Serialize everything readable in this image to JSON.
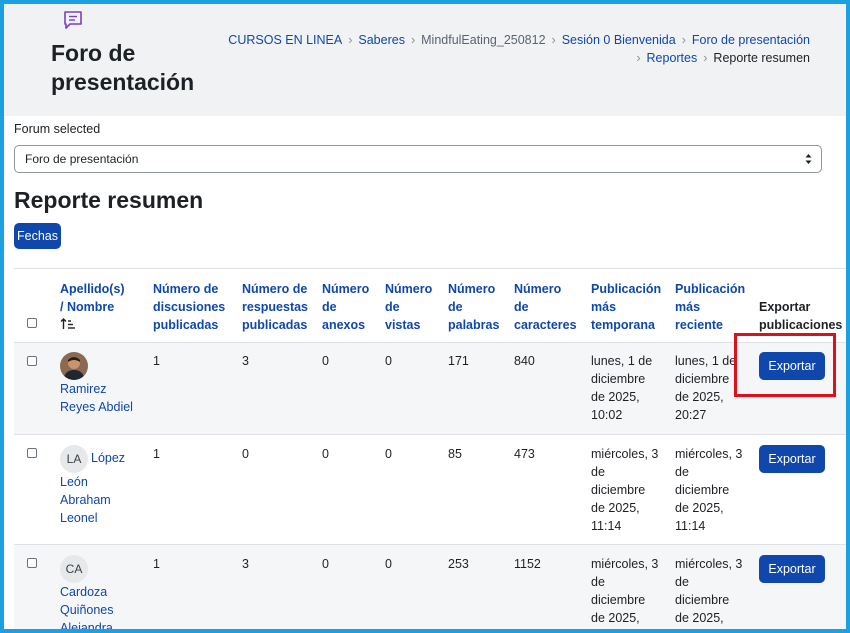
{
  "header": {
    "title_line1": "Foro de",
    "title_line2": "presentación",
    "breadcrumb": [
      "CURSOS EN LINEA",
      "Saberes",
      "MindfulEating_250812",
      "Sesión 0 Bienvenida",
      "Foro de presentación",
      "Reportes",
      "Reporte resumen"
    ]
  },
  "forum_select": {
    "label": "Forum selected",
    "value": "Foro de presentación"
  },
  "report": {
    "title": "Reporte resumen",
    "dates_button": "Fechas"
  },
  "table": {
    "headers": {
      "name": [
        "Apellido(s)",
        "/ Nombre"
      ],
      "discussions": [
        "Número de",
        "discusiones",
        "publicadas"
      ],
      "replies": [
        "Número de",
        "respuestas",
        "publicadas"
      ],
      "attachments": [
        "Número",
        "de",
        "anexos"
      ],
      "views": [
        "Número",
        "de",
        "vistas"
      ],
      "words": [
        "Número",
        "de",
        "palabras"
      ],
      "chars": [
        "Número",
        "de",
        "caracteres"
      ],
      "earliest": [
        "Publicación",
        "más",
        "temporana"
      ],
      "latest": [
        "Publicación",
        "más",
        "reciente"
      ],
      "export": [
        "Exportar",
        "publicaciones"
      ]
    },
    "sort_icon": "sort-ascending-icon",
    "rows": [
      {
        "avatar": "photo",
        "name": [
          "Ramirez",
          "Reyes Abdiel"
        ],
        "discussions": "1",
        "replies": "3",
        "attachments": "0",
        "views": "0",
        "words": "171",
        "chars": "840",
        "earliest": [
          "lunes, 1 de",
          "diciembre",
          "de 2025,",
          "10:02"
        ],
        "latest": [
          "lunes, 1 de",
          "diciembre",
          "de 2025,",
          "20:27"
        ],
        "export_label": "Exportar"
      },
      {
        "avatar": "LA",
        "name": [
          "López",
          "León",
          "Abraham",
          "Leonel"
        ],
        "discussions": "1",
        "replies": "0",
        "attachments": "0",
        "views": "0",
        "words": "85",
        "chars": "473",
        "earliest": [
          "miércoles, 3",
          "de",
          "diciembre",
          "de 2025,",
          "11:14"
        ],
        "latest": [
          "miércoles, 3",
          "de",
          "diciembre",
          "de 2025,",
          "11:14"
        ],
        "export_label": "Exportar"
      },
      {
        "avatar": "CA",
        "name": [
          "Cardoza",
          "Quiñones",
          "Alejandra"
        ],
        "discussions": "1",
        "replies": "3",
        "attachments": "0",
        "views": "0",
        "words": "253",
        "chars": "1152",
        "earliest": [
          "miércoles, 3",
          "de",
          "diciembre",
          "de 2025,"
        ],
        "latest": [
          "miércoles, 3",
          "de",
          "diciembre",
          "de 2025,"
        ],
        "export_label": "Exportar"
      }
    ]
  },
  "colors": {
    "link": "#0f47ad",
    "button": "#0f47ad",
    "highlight": "#e0101a",
    "frame": "#1ba1e2"
  }
}
